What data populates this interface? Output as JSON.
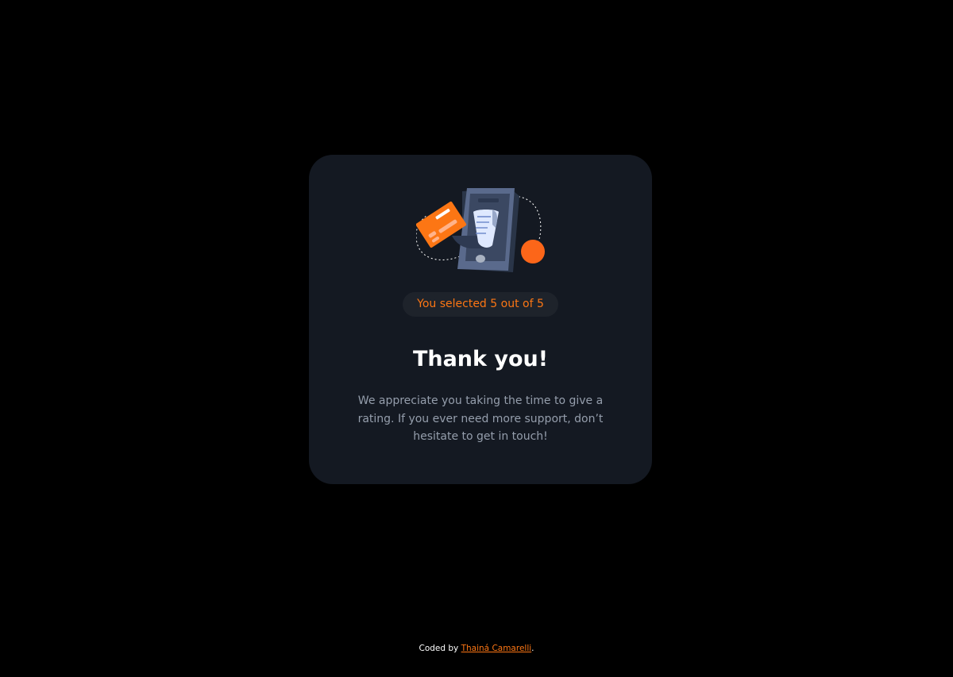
{
  "card": {
    "selection_text": "You selected 5 out of 5",
    "title": "Thank you!",
    "message": "We appreciate you taking the time to give a rating. If you ever need more support, don’t hesitate to get in touch!",
    "illustration_icon": "phone-payment-receipt-illustration"
  },
  "footer": {
    "coded_by_label": "Coded by",
    "author_name": "Thainá Camarelli",
    "trailing_punctuation": "."
  },
  "colors": {
    "background": "#000000",
    "card": "#141922",
    "accent": "#fc7614",
    "badge_background": "#1e232b",
    "text_muted": "#959eac",
    "text_light": "#ffffff"
  }
}
